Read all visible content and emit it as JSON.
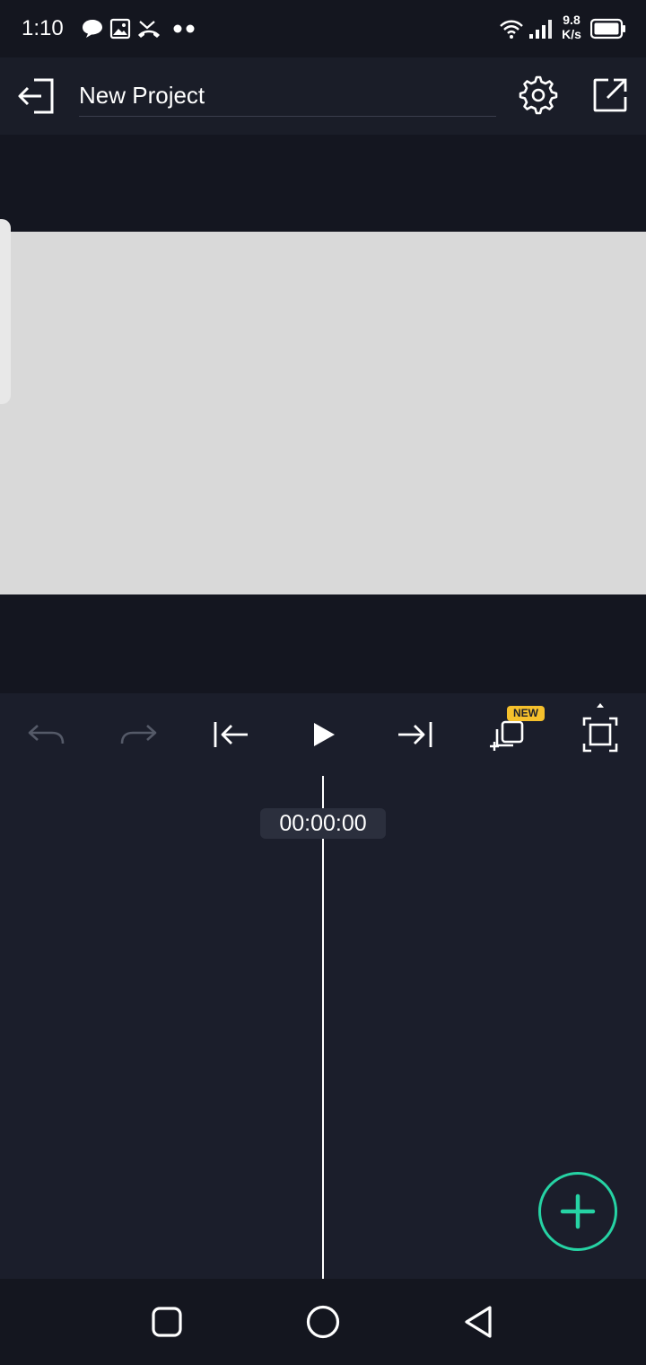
{
  "status_bar": {
    "time": "1:10",
    "network_speed_value": "9.8",
    "network_speed_unit": "K/s",
    "icons": [
      "chat-bubble-icon",
      "image-icon",
      "missed-call-icon",
      "more-dots-icon",
      "wifi-icon",
      "signal-icon",
      "battery-icon"
    ]
  },
  "header": {
    "project_name": "New Project",
    "icons": [
      "exit-icon",
      "settings-icon",
      "export-icon"
    ]
  },
  "playback": {
    "timecode": "00:00:00",
    "new_badge": "NEW",
    "icons": [
      "undo-icon",
      "redo-icon",
      "skip-to-start-icon",
      "play-icon",
      "skip-to-end-icon",
      "add-overlay-icon",
      "fullscreen-icon"
    ]
  },
  "fab": {
    "icon": "plus-icon"
  },
  "nav_bar": {
    "icons": [
      "recent-apps-icon",
      "home-icon",
      "back-icon"
    ]
  },
  "colors": {
    "background": "#14161f",
    "app_bar": "#1a1d28",
    "timeline_bg": "#1b1e2b",
    "canvas": "#d9d9d9",
    "accent": "#26d3a4",
    "badge": "#f5c02c"
  }
}
